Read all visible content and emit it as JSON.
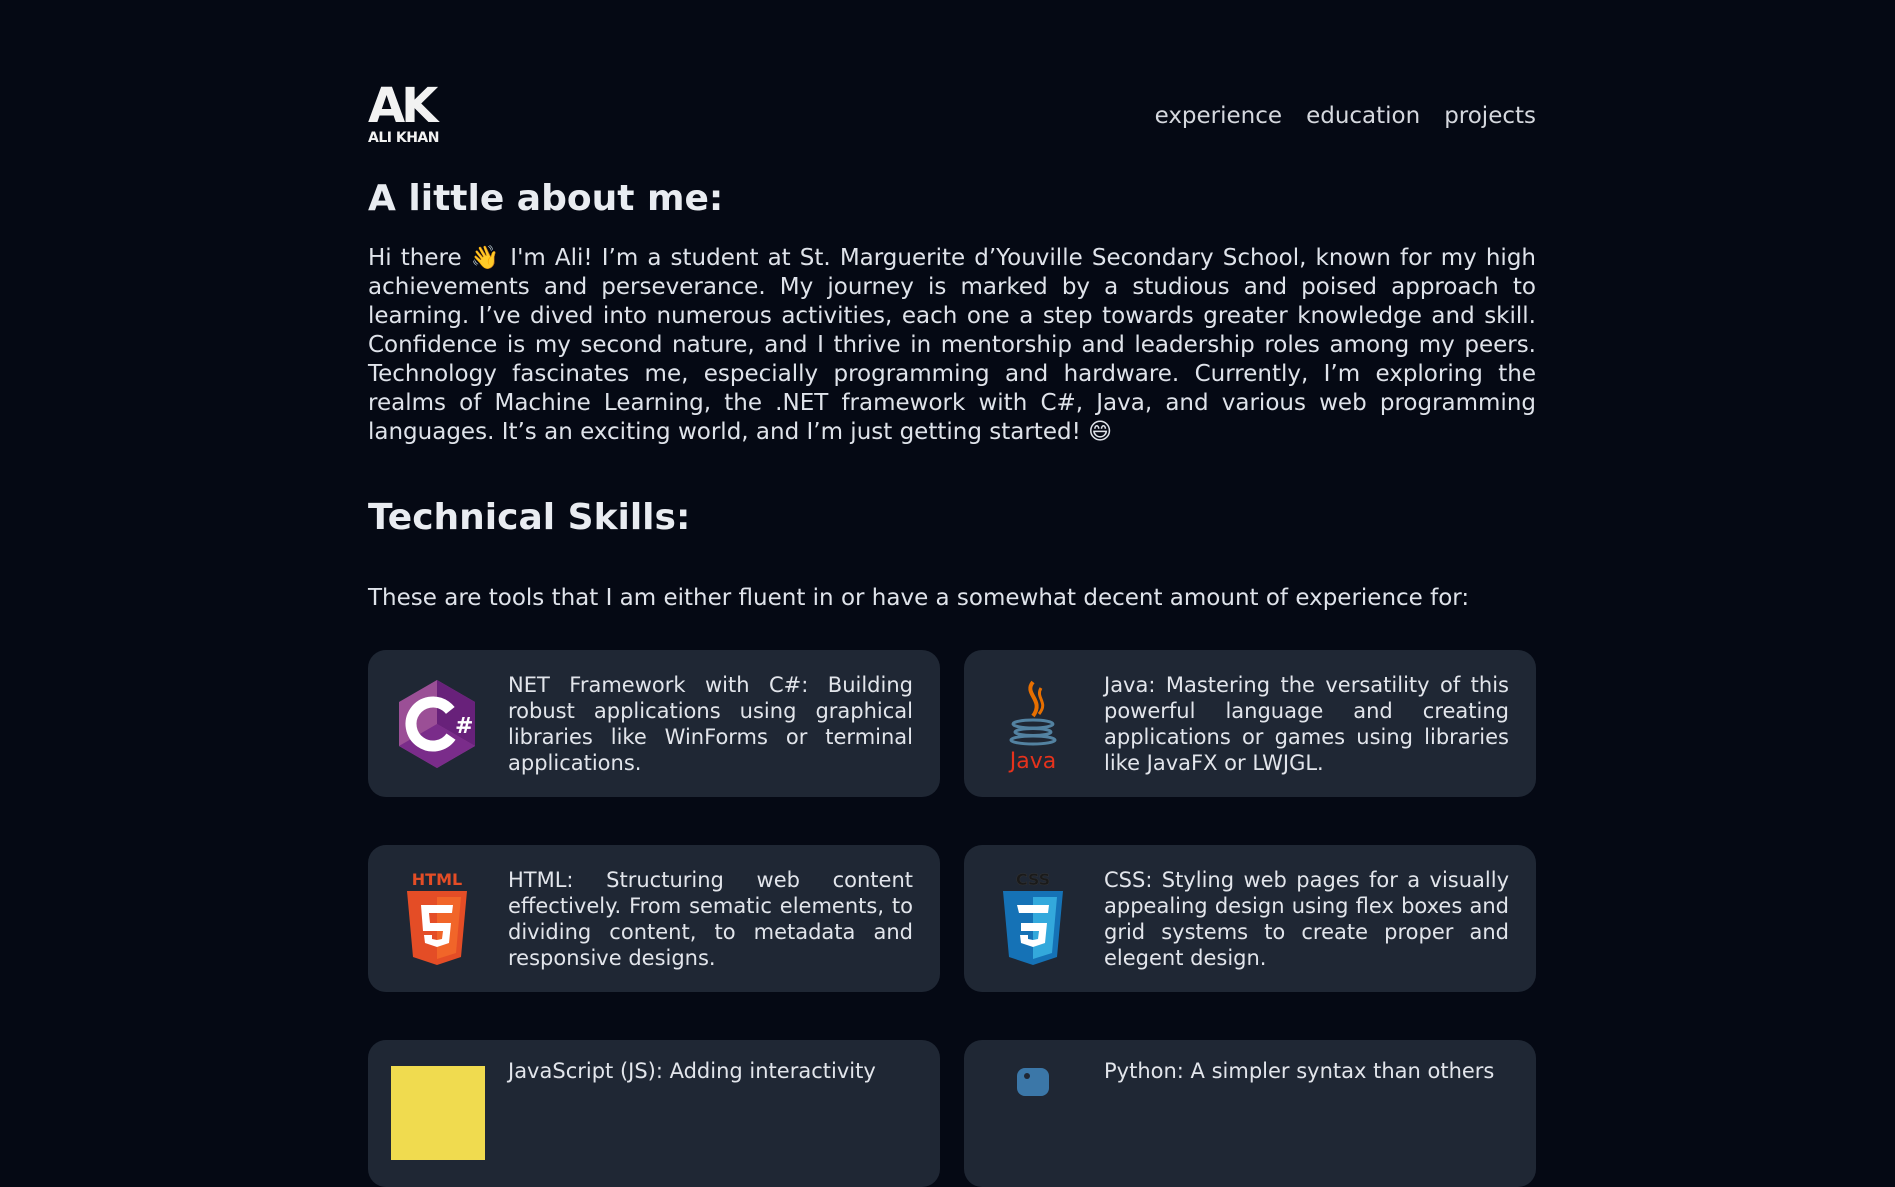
{
  "header": {
    "logo_mark": "AK",
    "logo_name": "ALI KHAN",
    "nav": [
      "experience",
      "education",
      "projects"
    ]
  },
  "about": {
    "title": "A little about me:",
    "text": "Hi there 👋 I'm Ali! I’m a student at St. Marguerite d’Youville Secondary School, known for my high achievements and perseverance. My journey is marked by a studious and poised approach to learning. I’ve dived into numerous activities, each one a step towards greater knowledge and skill. Confidence is my second nature, and I thrive in mentorship and leadership roles among my peers. Technology fascinates me, especially programming and hardware. Currently, I’m exploring the realms of Machine Learning, the .NET framework with C#, Java, and various web programming languages. It’s an exciting world, and I’m just getting started! 😄"
  },
  "skills": {
    "title": "Technical Skills:",
    "intro": "These are tools that I am either fluent in or have a somewhat decent amount of experience for:",
    "cards": [
      {
        "icon": "csharp-icon",
        "description": "NET Framework with C#: Building robust applications using graphical libraries like WinForms or terminal applications."
      },
      {
        "icon": "java-icon",
        "icon_label": "Java",
        "description": "Java: Mastering the versatility of this powerful language and creating applications or games using libraries like JavaFX or LWJGL."
      },
      {
        "icon": "html5-icon",
        "icon_label": "HTML",
        "description": "HTML: Structuring web content effectively. From sematic elements, to dividing content, to metadata and responsive designs."
      },
      {
        "icon": "css3-icon",
        "icon_label": "CSS",
        "description": "CSS: Styling web pages for a visually appealing design using flex boxes and grid systems to create proper and elegent design."
      },
      {
        "icon": "javascript-icon",
        "description": "JavaScript (JS): Adding interactivity"
      },
      {
        "icon": "python-icon",
        "description": "Python: A simpler syntax than others"
      }
    ]
  },
  "colors": {
    "background": "#050914",
    "card": "#1f2734",
    "text": "#e6e9ef"
  }
}
